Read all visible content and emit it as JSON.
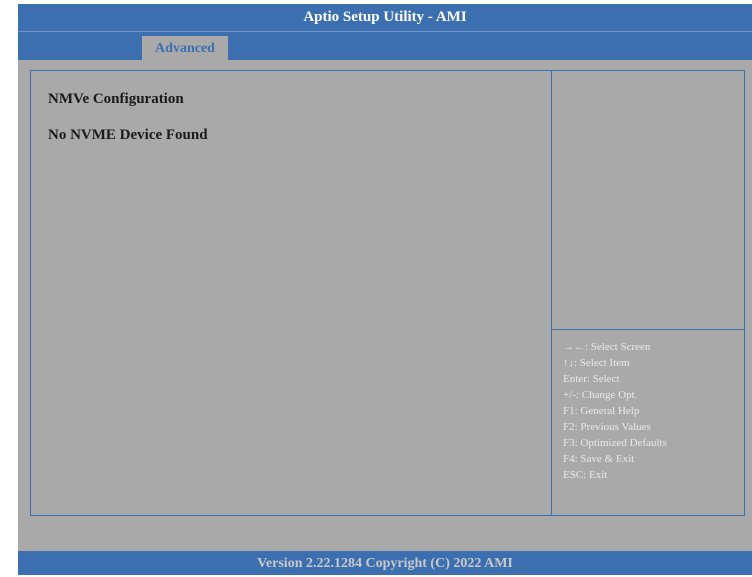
{
  "window": {
    "title": "Aptio Setup Utility - AMI"
  },
  "tabs": [
    {
      "label": "Advanced",
      "active": true
    }
  ],
  "main": {
    "items": [
      {
        "label": "NMVe Configuration"
      },
      {
        "label": "No NVME Device Found"
      }
    ]
  },
  "help": {
    "description": "",
    "keys": [
      "→←: Select Screen",
      "↑↓: Select Item",
      "Enter: Select",
      "+/-: Change Opt.",
      "F1: General Help",
      "F2: Previous Values",
      "F3: Optimized Defaults",
      "F4: Save & Exit",
      "ESC: Exit"
    ]
  },
  "footer": {
    "version": "Version 2.22.1284 Copyright (C) 2022 AMI"
  },
  "colors": {
    "header_blue": "#3c6fb0",
    "panel_gray": "#a9a9a9",
    "help_text": "#eaeaea"
  }
}
